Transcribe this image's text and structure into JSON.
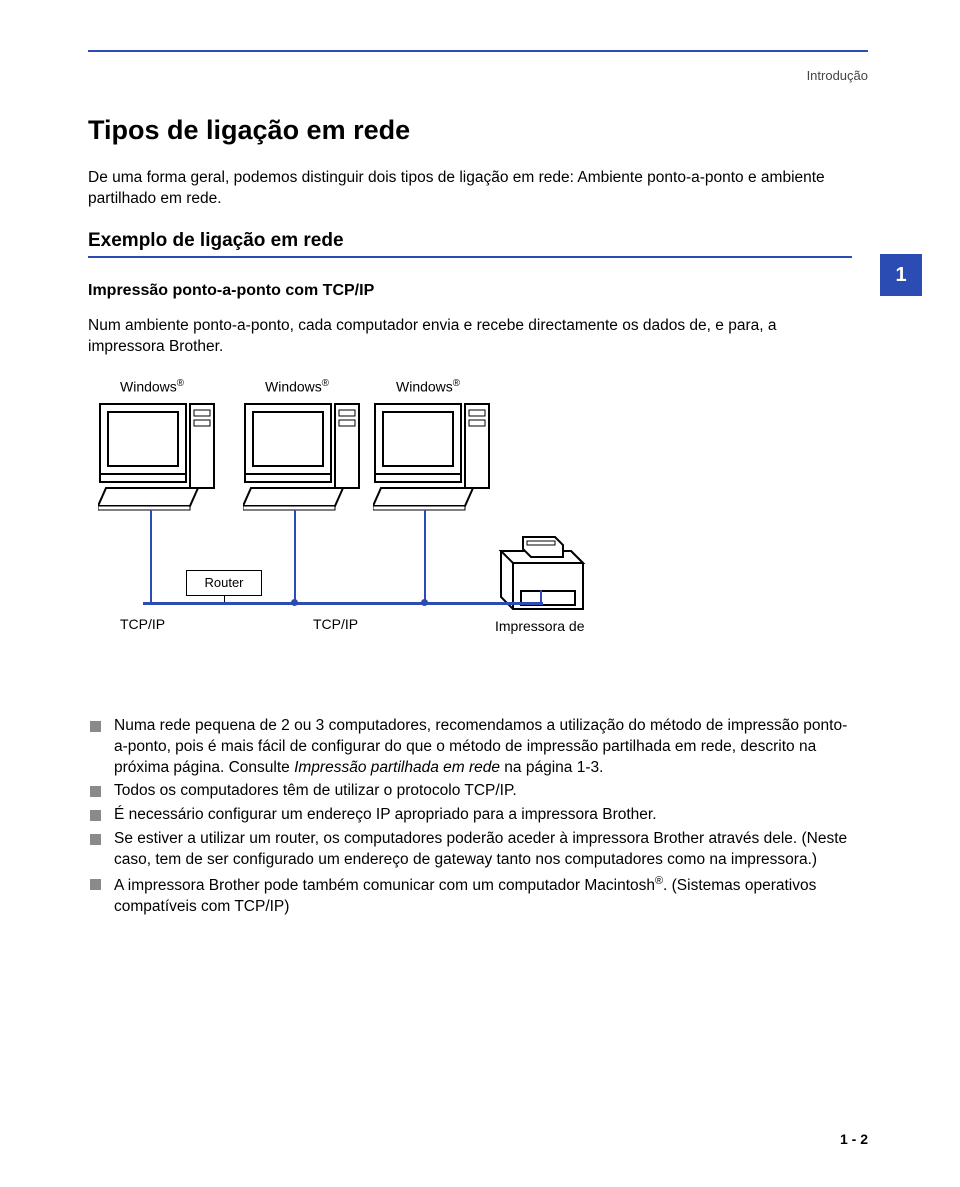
{
  "header": {
    "right": "Introdução"
  },
  "chapter_number": "1",
  "h1": "Tipos de ligação em rede",
  "intro": "De uma forma geral, podemos distinguir dois tipos de ligação em rede: Ambiente ponto-a-ponto e ambiente partilhado em rede.",
  "h2": "Exemplo de ligação em rede",
  "h3": "Impressão ponto-a-ponto com TCP/IP",
  "h3_body": "Num ambiente ponto-a-ponto, cada computador envia e recebe directamente os dados de, e para, a impressora Brother.",
  "diagram": {
    "pc1": "Windows",
    "pc2": "Windows",
    "pc3": "Windows",
    "reg": "®",
    "router": "Router",
    "tcpip_left": "TCP/IP",
    "tcpip_mid": "TCP/IP",
    "printer": "Impressora de"
  },
  "bullets": {
    "b1a": "Numa rede pequena de 2 ou 3 computadores, recomendamos a utilização do método de impressão ponto-a-ponto, pois é mais fácil de configurar do que o método de impressão partilhada em rede, descrito na próxima página. Consulte ",
    "b1b": "Impressão partilhada em rede",
    "b1c": " na página 1-3.",
    "b2": "Todos os computadores têm de utilizar o protocolo TCP/IP.",
    "b3": "É necessário configurar um endereço IP apropriado para a impressora Brother.",
    "b4": "Se estiver a utilizar um router, os computadores poderão aceder à impressora Brother através dele. (Neste caso, tem de ser configurado um endereço de gateway tanto nos computadores como na impressora.)",
    "b5a": "A impressora Brother pode também comunicar com um computador Macintosh",
    "b5b": ". (Sistemas operativos compatíveis com TCP/IP)"
  },
  "footer": "1 - 2"
}
